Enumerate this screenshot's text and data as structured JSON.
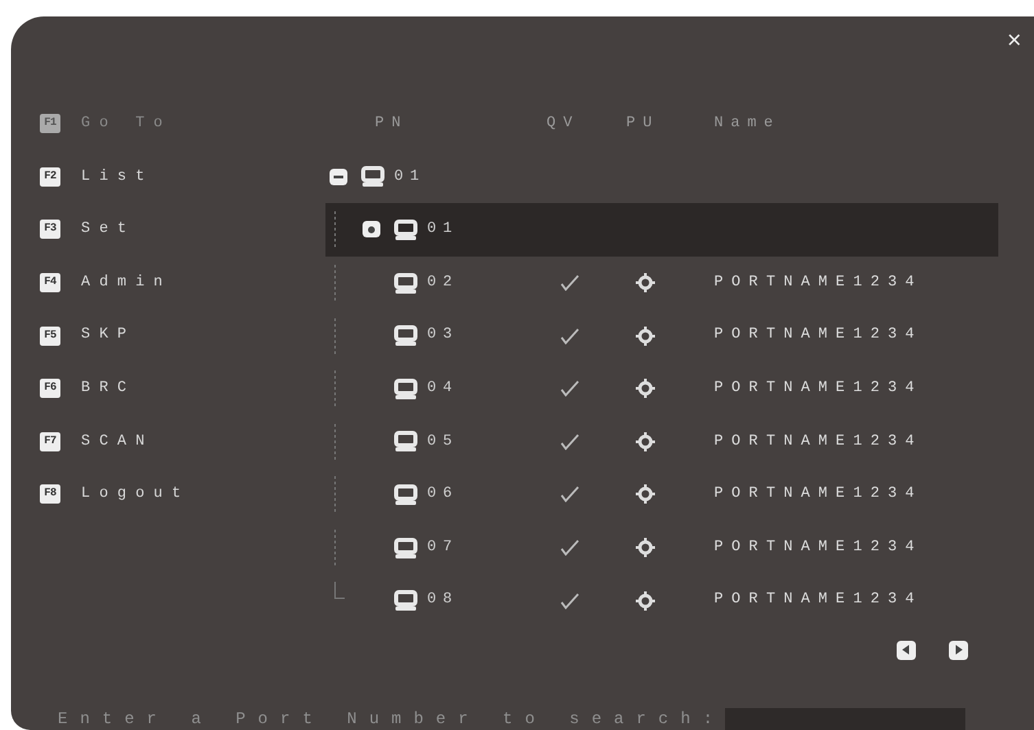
{
  "close": "×",
  "sidebar": {
    "items": [
      {
        "key": "F1",
        "label": "Go To",
        "disabled": true
      },
      {
        "key": "F2",
        "label": "List",
        "disabled": false
      },
      {
        "key": "F3",
        "label": "Set",
        "disabled": false
      },
      {
        "key": "F4",
        "label": "Admin",
        "disabled": false
      },
      {
        "key": "F5",
        "label": "SKP",
        "disabled": false
      },
      {
        "key": "F6",
        "label": "BRC",
        "disabled": false
      },
      {
        "key": "F7",
        "label": "SCAN",
        "disabled": false
      },
      {
        "key": "F8",
        "label": "Logout",
        "disabled": false
      }
    ]
  },
  "table": {
    "columns": [
      "PN",
      "QV",
      "PU",
      "Name"
    ],
    "tree": [
      {
        "pn": "01",
        "expanded": true,
        "selected": false,
        "children": [
          {
            "pn": "01",
            "expanded": false,
            "selected": true
          },
          {
            "pn": "02",
            "selected": false,
            "qv": true,
            "name": "PORTNAME1234"
          },
          {
            "pn": "03",
            "selected": false,
            "qv": true,
            "name": "PORTNAME1234"
          },
          {
            "pn": "04",
            "selected": false,
            "qv": true,
            "name": "PORTNAME1234"
          },
          {
            "pn": "05",
            "selected": false,
            "qv": true,
            "name": "PORTNAME1234"
          },
          {
            "pn": "06",
            "selected": false,
            "qv": true,
            "name": "PORTNAME1234"
          },
          {
            "pn": "07",
            "selected": false,
            "qv": true,
            "name": "PORTNAME1234"
          },
          {
            "pn": "08",
            "selected": false,
            "qv": true,
            "name": "PORTNAME1234"
          }
        ]
      }
    ]
  },
  "search": {
    "label": "Enter a Port Number to search:"
  }
}
